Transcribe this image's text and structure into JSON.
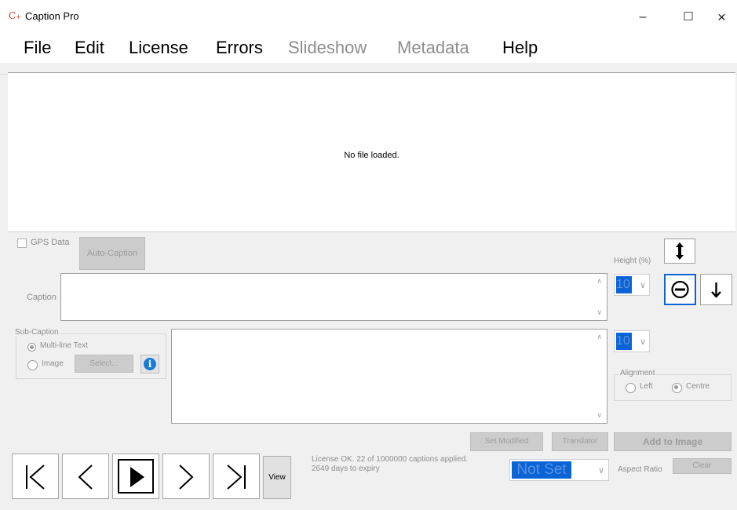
{
  "window": {
    "title": "Caption Pro",
    "minimize": "–",
    "maximize": "☐",
    "close": "✕"
  },
  "menu": {
    "items": [
      {
        "label": "File",
        "enabled": true
      },
      {
        "label": "Edit",
        "enabled": true
      },
      {
        "label": "License",
        "enabled": true
      },
      {
        "label": "Errors",
        "enabled": true
      },
      {
        "label": "Slideshow",
        "enabled": false
      },
      {
        "label": "Metadata",
        "enabled": false
      },
      {
        "label": "Help",
        "enabled": true
      }
    ]
  },
  "viewer": {
    "message": "No file loaded."
  },
  "caption_panel": {
    "gps_label": "GPS Data",
    "auto_caption_label": "Auto-Caption",
    "caption_label": "Caption",
    "caption_value": "",
    "height_label": "Height (%)",
    "height_value": "10",
    "sub_height_value": "10"
  },
  "sub_caption": {
    "group_label": "Sub-Caption",
    "multiline_label": "Multi-line Text",
    "image_label": "Image",
    "select_label": "Select...",
    "info_icon": "i",
    "text_value": ""
  },
  "alignment": {
    "group_label": "Alignment",
    "left_label": "Left",
    "centre_label": "Centre",
    "selected": "Centre"
  },
  "actions": {
    "set_modified": "Set Modified",
    "translator": "Translator",
    "add_to_image": "Add to Image",
    "view": "View",
    "clear": "Clear"
  },
  "status": {
    "license_line1": "License OK. 22 of 1000000 captions applied.",
    "license_line2": "2649 days to expiry"
  },
  "aspect": {
    "value": "Not Set",
    "label": "Aspect Ratio"
  },
  "icons": {
    "app": "caption-pro-logo",
    "move_vertical": "up-down-arrow-icon",
    "centre_position": "circle-minus-icon",
    "move_down": "down-arrow-icon",
    "nav": [
      "first-icon",
      "previous-icon",
      "play-icon",
      "next-icon",
      "last-icon"
    ]
  },
  "colors": {
    "selection_blue": "#0a64d6",
    "active_border": "#0a64d6",
    "disabled_text": "#8d8d8d"
  }
}
